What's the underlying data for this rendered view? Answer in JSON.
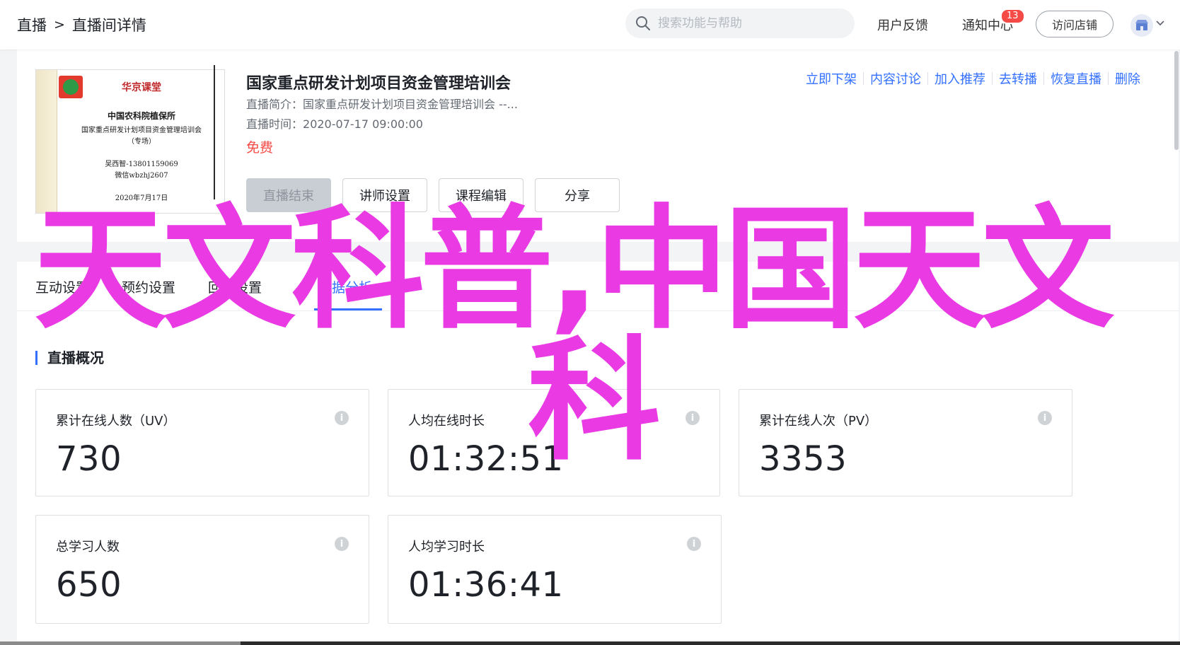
{
  "breadcrumb": {
    "root": "直播",
    "separator": ">",
    "current": "直播间详情"
  },
  "search": {
    "placeholder": "搜索功能与帮助"
  },
  "header": {
    "feedback": "用户反馈",
    "notifications": "通知中心",
    "notification_count": "13",
    "visit_store": "访问店铺"
  },
  "course": {
    "title": "国家重点研发计划项目资金管理培训会",
    "intro_label": "直播简介：",
    "intro": "国家重点研发计划项目资金管理培训会 --...",
    "time_label": "直播时间：",
    "time": "2020-07-17 09:00:00",
    "price": "免费",
    "cover": {
      "brand": "华京课堂",
      "org": "中国农科院植保所",
      "event": "国家重点研发计划项目资金管理培训会",
      "note": "（专场）",
      "contact1": "吴西智-13801159069",
      "contact2": "微信wbzhj2607",
      "date": "2020年7月17日"
    },
    "actions": [
      "立即下架",
      "内容讨论",
      "加入推荐",
      "去转播",
      "恢复直播",
      "删除"
    ],
    "buttons": {
      "end_live": "直播结束",
      "lecturer": "讲师设置",
      "edit": "课程编辑",
      "share": "分享"
    }
  },
  "tabs": [
    "互动设置",
    "预约设置",
    "回放设置",
    "数据分析"
  ],
  "overview": {
    "title": "直播概况",
    "cards": [
      {
        "label": "累计在线人数（UV）",
        "value": "730"
      },
      {
        "label": "人均在线时长",
        "value": "01:32:51"
      },
      {
        "label": "累计在线人次（PV）",
        "value": "3353"
      },
      {
        "label": "总学习人数",
        "value": "650"
      },
      {
        "label": "人均学习时长",
        "value": "01:36:41"
      }
    ]
  },
  "overlay_text": {
    "line1": "天文科普,中国天文",
    "line2": "科"
  },
  "colors": {
    "accent": "#3370ff",
    "price": "#f54a45",
    "overlay": "#e93ae4"
  }
}
